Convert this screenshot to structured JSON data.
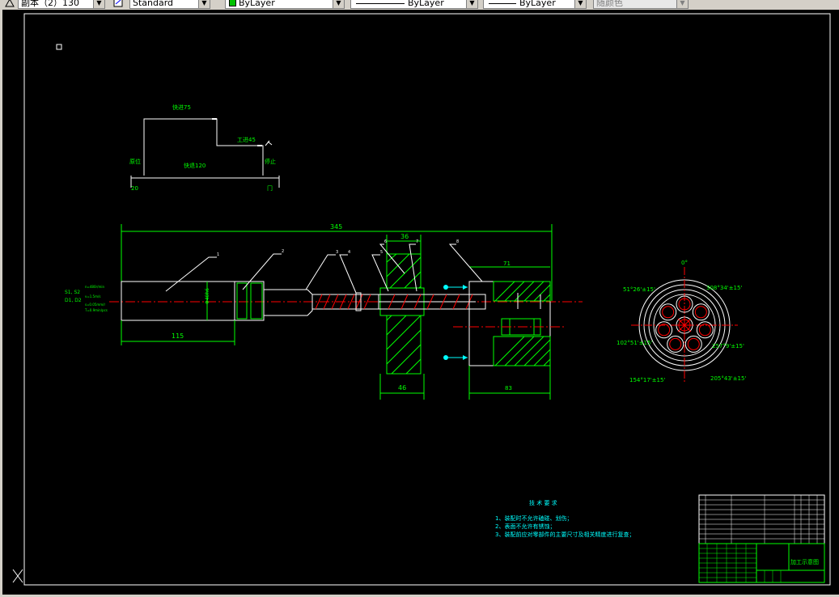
{
  "toolbar": {
    "plot_scale_label": "副本（2）130",
    "text_style": "Standard",
    "layer_color": "ByLayer",
    "linetype": "ByLayer",
    "lineweight": "ByLayer",
    "plot_style": "随颜色",
    "layer_swatch_color": "#00c000"
  },
  "drawing": {
    "process_chart": {
      "label_fast_feed": "快进75",
      "label_work_feed": "工进45",
      "label_start": "原位",
      "label_fast_return": "快退120",
      "label_stop": "停止",
      "dim_left": "20",
      "dim_right": "冂"
    },
    "main_view": {
      "overall_length": "345",
      "dim_115": "115",
      "dim_36": "36",
      "dim_46": "46",
      "dim_71": "71",
      "dim_83": "83",
      "left_note_1": "S1, S2",
      "left_note_2": "D1, D2",
      "left_spec_1": "n=480r/min",
      "left_spec_2": "v=1.5m/s",
      "left_spec_3": "s=0.05mm/r",
      "left_spec_4": "T=0.9min/pcs",
      "callouts": [
        "1",
        "2",
        "3",
        "4",
        "5",
        "6",
        "7",
        "8"
      ]
    },
    "end_view": {
      "angle_top": "0°",
      "angle_1": "51°26'±15'",
      "angle_2": "308°34'±15'",
      "angle_3": "102°51'±15'",
      "angle_4": "257°9'±15'",
      "angle_5": "154°17'±15'",
      "angle_6": "205°43'±15'"
    },
    "tech_requirements": {
      "title": "技 术 要 求",
      "item_1": "1、装配时不允许磕碰、划伤；",
      "item_2": "2、表面不允许有锈蚀；",
      "item_3": "3、装配前应对零部件的主要尺寸及相关精度进行复查；"
    },
    "title_block": {
      "drawing_name": "加工示意图"
    },
    "colors": {
      "frame": "#ffffff",
      "geometry": "#ffffff",
      "dimension": "#00ff00",
      "center": "#ff0000",
      "hatch": "#00ff00",
      "cyan": "#00ffff",
      "yellow": "#ffff00"
    }
  }
}
